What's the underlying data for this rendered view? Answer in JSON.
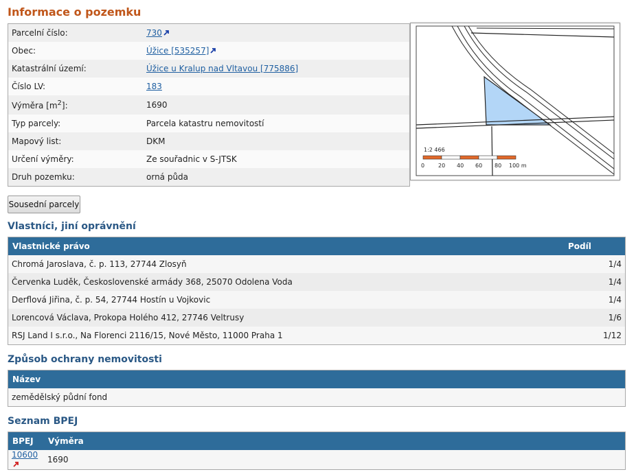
{
  "title": "Informace o pozemku",
  "info": {
    "rows": [
      {
        "label": "Parcelní číslo:",
        "value": "730"
      },
      {
        "label": "Obec:",
        "value": "Úžice [535257]"
      },
      {
        "label": "Katastrální území:",
        "value": "Úžice u Kralup nad Vltavou [775886]"
      },
      {
        "label": "Číslo LV:",
        "value": "183"
      },
      {
        "label": "Výměra [m",
        "label_sup": "2",
        "label_end": "]:",
        "value": "1690"
      },
      {
        "label": "Typ parcely:",
        "value": "Parcela katastru nemovitostí"
      },
      {
        "label": "Mapový list:",
        "value": "DKM"
      },
      {
        "label": "Určení výměry:",
        "value": "Ze souřadnic v S-JTSK"
      },
      {
        "label": "Druh pozemku:",
        "value": "orná půda"
      }
    ]
  },
  "map": {
    "scale_label": "1:2 466",
    "ticks": [
      "0",
      "20",
      "40",
      "60",
      "80",
      "100 m"
    ],
    "parcel_color": "#b3d6f7",
    "scale_color": "#e2692a"
  },
  "neighbors_button": "Sousední parcely",
  "owners": {
    "heading": "Vlastníci, jiní oprávnění",
    "col_owner": "Vlastnické právo",
    "col_share": "Podíl",
    "rows": [
      {
        "name": "Chromá Jaroslava, č. p. 113, 27744 Zlosyň",
        "share": "1/4"
      },
      {
        "name": "Červenka Luděk, Československé armády 368, 25070 Odolena Voda",
        "share": "1/4"
      },
      {
        "name": "Derflová Jiřina, č. p. 54, 27744 Hostín u Vojkovic",
        "share": "1/4"
      },
      {
        "name": "Lorencová Václava, Prokopa Holého 412, 27746 Veltrusy",
        "share": "1/6"
      },
      {
        "name": "RSJ Land I s.r.o., Na Florenci 2116/15, Nové Město, 11000 Praha 1",
        "share": "1/12"
      }
    ]
  },
  "protection": {
    "heading": "Způsob ochrany nemovitosti",
    "col_name": "Název",
    "rows": [
      {
        "name": "zemědělský půdní fond"
      }
    ]
  },
  "bpej": {
    "heading": "Seznam BPEJ",
    "col_bpej": "BPEJ",
    "col_area": "Výměra",
    "rows": [
      {
        "code": "10600",
        "area": "1690"
      }
    ]
  }
}
